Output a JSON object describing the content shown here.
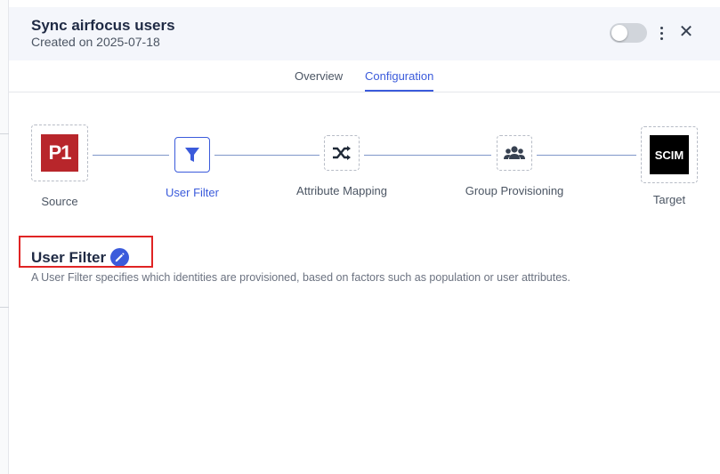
{
  "header": {
    "title": "Sync airfocus users",
    "subtitle": "Created on 2025-07-18"
  },
  "tabs": [
    {
      "label": "Overview",
      "active": false
    },
    {
      "label": "Configuration",
      "active": true
    }
  ],
  "flow": {
    "source": {
      "label": "Source",
      "logo_text": "P1"
    },
    "user_filter": {
      "label": "User Filter",
      "icon": "filter-icon"
    },
    "attribute_mapping": {
      "label": "Attribute Mapping",
      "icon": "shuffle-icon"
    },
    "group_provisioning": {
      "label": "Group Provisioning",
      "icon": "users-icon"
    },
    "target": {
      "label": "Target",
      "logo_text": "SCIM"
    }
  },
  "section": {
    "title": "User Filter",
    "description": "A User Filter specifies which identities are provisioned, based on factors such as population or user attributes."
  },
  "colors": {
    "accent": "#3b5bdb",
    "highlight": "#e02424",
    "source_logo_bg": "#b8262b",
    "target_logo_bg": "#000000"
  }
}
